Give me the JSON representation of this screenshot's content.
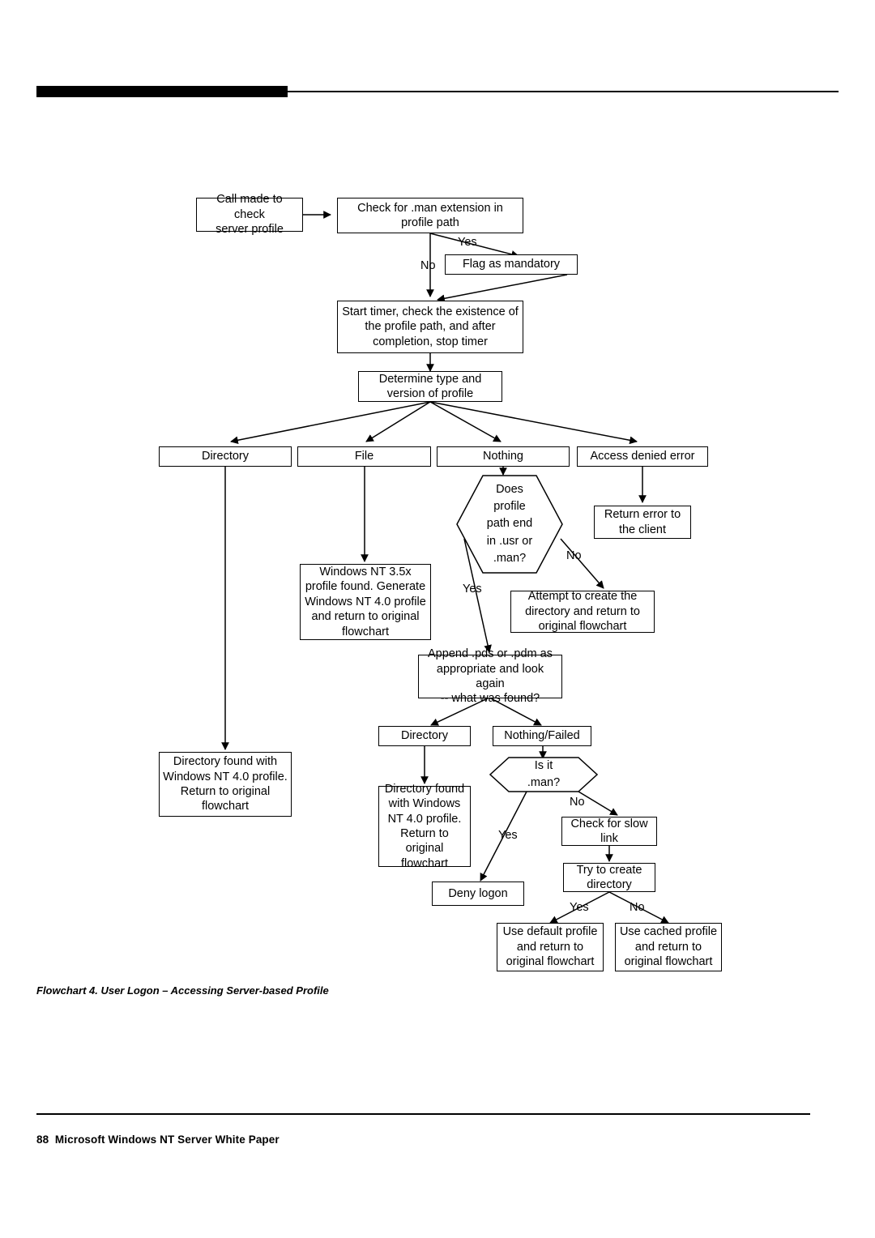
{
  "page": {
    "footer_page_number": "88",
    "footer_text": "88  Microsoft Windows NT Server White Paper",
    "figure_caption": "Flowchart 4. User Logon – Accessing Server-based Profile",
    "accent_color": "#000000",
    "background_color": "#ffffff"
  },
  "flowchart": {
    "title": "User Logon – Accessing Server-based Profile",
    "type": "flowchart",
    "nodes": [
      {
        "id": "call_made",
        "shape": "process",
        "text": "Call made to check\nserver profile"
      },
      {
        "id": "check_man",
        "shape": "process",
        "text": "Check for .man extension in\nprofile path"
      },
      {
        "id": "flag_mandatory",
        "shape": "process",
        "text": "Flag as mandatory"
      },
      {
        "id": "start_timer",
        "shape": "process",
        "text": "Start timer, check the existence of\nthe profile path, and after\ncompletion, stop timer"
      },
      {
        "id": "determine_type",
        "shape": "process",
        "text": "Determine type and\nversion of profile"
      },
      {
        "id": "directory",
        "shape": "process",
        "text": "Directory"
      },
      {
        "id": "file",
        "shape": "process",
        "text": "File"
      },
      {
        "id": "nothing",
        "shape": "process",
        "text": "Nothing"
      },
      {
        "id": "access_denied",
        "shape": "process",
        "text": "Access denied error"
      },
      {
        "id": "return_error",
        "shape": "process",
        "text": "Return error to\nthe client"
      },
      {
        "id": "does_path_end",
        "shape": "decision",
        "text": "Does\nprofile\npath end\nin .usr or\n.man?"
      },
      {
        "id": "win35x",
        "shape": "process",
        "text": "Windows NT 3.5x\nprofile found. Generate\nWindows NT 4.0 profile\nand return to original\nflowchart"
      },
      {
        "id": "attempt_create",
        "shape": "process",
        "text": "Attempt to create the\ndirectory and return to\noriginal flowchart"
      },
      {
        "id": "append_pds",
        "shape": "process",
        "text": "Append .pds or .pdm as\nappropriate and look again\n-- what was found?"
      },
      {
        "id": "dir_found_left",
        "shape": "process",
        "text": "Directory found with\nWindows NT 4.0 profile.\nReturn to original\nflowchart"
      },
      {
        "id": "directory2",
        "shape": "process",
        "text": "Directory"
      },
      {
        "id": "nothing_failed",
        "shape": "process",
        "text": "Nothing/Failed"
      },
      {
        "id": "dir_found_mid",
        "shape": "process",
        "text": "Directory found\nwith Windows\nNT 4.0 profile.\nReturn to\noriginal\nflowchart"
      },
      {
        "id": "is_it_man",
        "shape": "decision",
        "text": "Is it\n.man?"
      },
      {
        "id": "deny_logon",
        "shape": "process",
        "text": "Deny logon"
      },
      {
        "id": "check_slow_link",
        "shape": "process",
        "text": "Check for slow\nlink"
      },
      {
        "id": "try_create_dir",
        "shape": "process",
        "text": "Try to create\ndirectory"
      },
      {
        "id": "use_default",
        "shape": "process",
        "text": "Use default profile\nand return to\noriginal flowchart"
      },
      {
        "id": "use_cached",
        "shape": "process",
        "text": "Use cached profile\nand return to\noriginal flowchart"
      }
    ],
    "edge_labels": {
      "check_man_yes": "Yes",
      "check_man_no": "No",
      "path_end_yes": "Yes",
      "path_end_no": "No",
      "is_man_yes": "Yes",
      "is_man_no": "No",
      "try_create_yes": "Yes",
      "try_create_no": "No"
    }
  }
}
